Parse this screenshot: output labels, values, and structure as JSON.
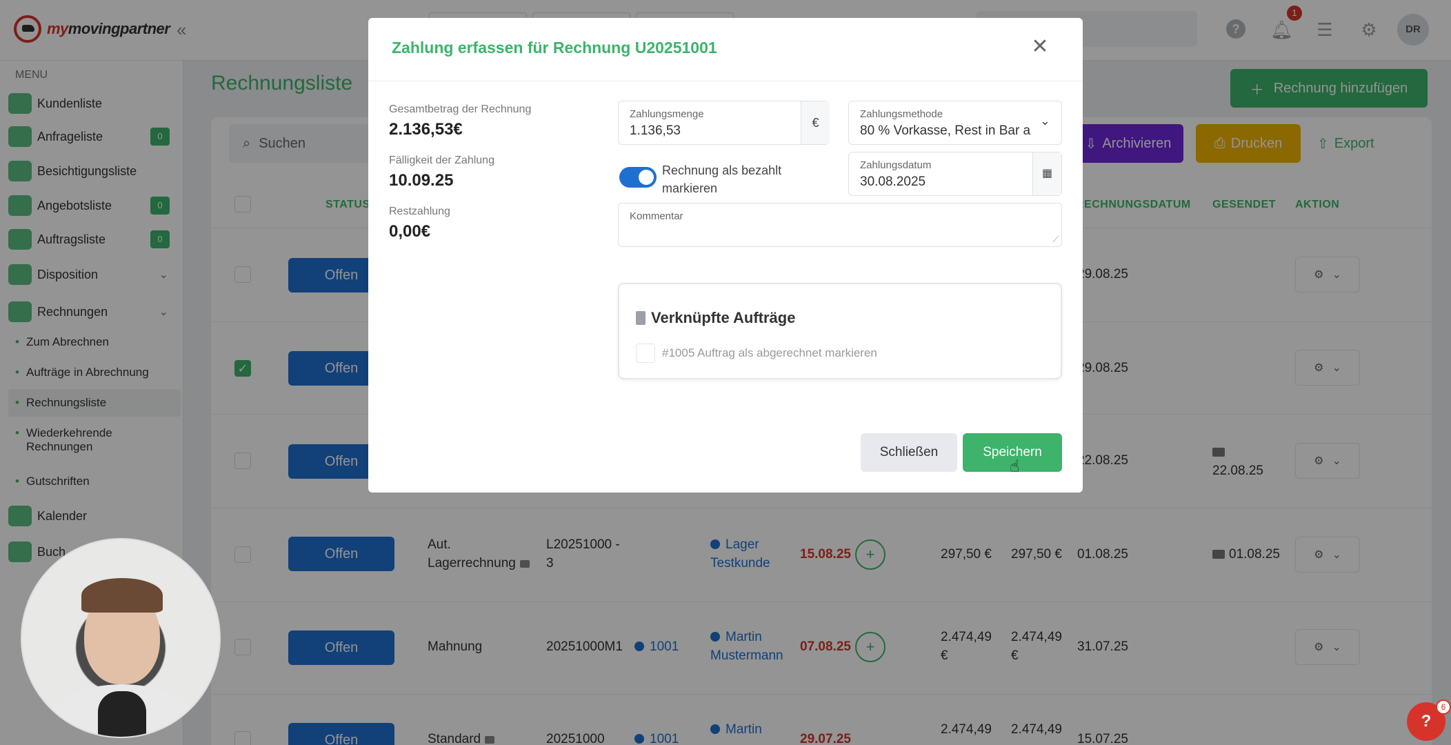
{
  "brand": {
    "logo_text_1": "my",
    "logo_text_2": "movingpartner"
  },
  "topbar": {
    "notifications_count": "1",
    "avatar_initials": "DR"
  },
  "sidebar": {
    "menu_label": "MENU",
    "items": [
      {
        "label": "Kundenliste"
      },
      {
        "label": "Anfrageliste",
        "badge": "0"
      },
      {
        "label": "Besichtigungsliste"
      },
      {
        "label": "Angebotsliste",
        "badge": "0"
      },
      {
        "label": "Auftragsliste",
        "badge": "0"
      },
      {
        "label": "Disposition"
      },
      {
        "label": "Rechnungen"
      },
      {
        "label": "Kalender"
      },
      {
        "label": "Buch"
      }
    ],
    "sub_items": [
      "Zum Abrechnen",
      "Aufträge in Abrechnung",
      "Rechnungsliste",
      "Wiederkehrende",
      "Rechnungen",
      "Gutschriften"
    ]
  },
  "main": {
    "title": "Rechnungsliste",
    "add_button": "Rechnung hinzufügen",
    "search_placeholder": "Suchen",
    "archive_button": "Archivieren",
    "print_button": "Drucken",
    "export_button": "Export",
    "columns": {
      "status": "STATUS",
      "invoice_date": "RECHNUNGSDATUM",
      "sent": "GESENDET",
      "action": "AKTION"
    },
    "rows": [
      {
        "status": "Offen",
        "date": "29.08.25"
      },
      {
        "status": "Offen",
        "date": "29.08.25"
      },
      {
        "status": "Offen",
        "date": "22.08.25",
        "sent": "22.08.25"
      },
      {
        "status": "Offen",
        "type_1": "Aut.",
        "type_2": "Lagerrechnung",
        "number_1": "L20251000 -",
        "number_2": "3",
        "customer_1": "Lager",
        "customer_2": "Testkunde",
        "due": "15.08.25",
        "total": "297,50 €",
        "open": "297,50 €",
        "date": "01.08.25",
        "sent": "01.08.25"
      },
      {
        "status": "Offen",
        "type": "Mahnung",
        "number": "20251000M1",
        "order": "1001",
        "customer_1": "Martin",
        "customer_2": "Mustermann",
        "due": "07.08.25",
        "total_1": "2.474,49",
        "total_2": "€",
        "open_1": "2.474,49",
        "open_2": "€",
        "date": "31.07.25"
      },
      {
        "status": "Offen",
        "type": "Standard",
        "number": "20251000",
        "order": "1001",
        "customer_1": "Martin",
        "due": "29.07.25",
        "total_1": "2.474,49",
        "open_1": "2.474,49",
        "date": "15.07.25"
      }
    ]
  },
  "modal": {
    "title": "Zahlung erfassen für Rechnung U20251001",
    "total_label": "Gesamtbetrag der Rechnung",
    "total_value": "2.136,53€",
    "due_label": "Fälligkeit der Zahlung",
    "due_value": "10.09.25",
    "rest_label": "Restzahlung",
    "rest_value": "0,00€",
    "amount_label": "Zahlungsmenge",
    "amount_value": "1.136,53",
    "currency": "€",
    "method_label": "Zahlungsmethode",
    "method_value": "80 % Vorkasse, Rest in Bar a",
    "toggle_label": "Rechnung als bezahlt markieren",
    "toggle_on": true,
    "date_label": "Zahlungsdatum",
    "date_value": "30.08.2025",
    "comment_label": "Kommentar",
    "linked_title": "Verknüpfte Aufträge",
    "linked_item": "#1005 Auftrag als abgerechnet markieren",
    "close_button": "Schließen",
    "save_button": "Speichern"
  },
  "help": {
    "label": "?",
    "badge": "6"
  }
}
